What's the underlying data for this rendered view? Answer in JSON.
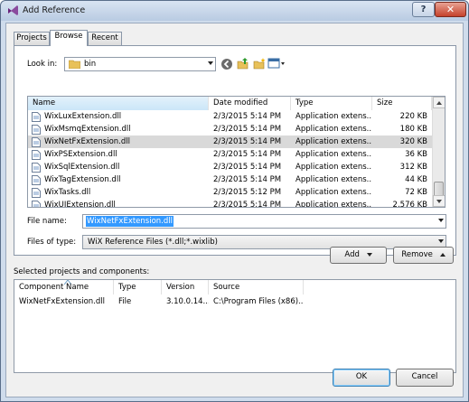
{
  "window": {
    "title": "Add Reference",
    "help_label": "?",
    "close_label": "✕"
  },
  "tabs": [
    {
      "label": "Projects"
    },
    {
      "label": "Browse"
    },
    {
      "label": "Recent"
    }
  ],
  "browse": {
    "look_in_label": "Look in:",
    "look_in_value": "bin",
    "toolbar_icons": [
      "back-icon",
      "up-folder-icon",
      "new-folder-icon",
      "view-menu-icon"
    ],
    "columns": [
      "Name",
      "Date modified",
      "Type",
      "Size"
    ],
    "files": [
      {
        "name": "WixLuxExtension.dll",
        "date": "2/3/2015 5:14 PM",
        "type": "Application extens...",
        "size": "220 KB"
      },
      {
        "name": "WixMsmqExtension.dll",
        "date": "2/3/2015 5:14 PM",
        "type": "Application extens...",
        "size": "180 KB"
      },
      {
        "name": "WixNetFxExtension.dll",
        "date": "2/3/2015 5:14 PM",
        "type": "Application extens...",
        "size": "320 KB"
      },
      {
        "name": "WixPSExtension.dll",
        "date": "2/3/2015 5:14 PM",
        "type": "Application extens...",
        "size": "36 KB"
      },
      {
        "name": "WixSqlExtension.dll",
        "date": "2/3/2015 5:14 PM",
        "type": "Application extens...",
        "size": "312 KB"
      },
      {
        "name": "WixTagExtension.dll",
        "date": "2/3/2015 5:14 PM",
        "type": "Application extens...",
        "size": "44 KB"
      },
      {
        "name": "WixTasks.dll",
        "date": "2/3/2015 5:12 PM",
        "type": "Application extens...",
        "size": "72 KB"
      },
      {
        "name": "WixUIExtension.dll",
        "date": "2/3/2015 5:14 PM",
        "type": "Application extens...",
        "size": "2,576 KB"
      }
    ],
    "selected_index": 2,
    "file_name_label": "File name:",
    "file_name_value": "WixNetFxExtension.dll",
    "file_type_label": "Files of type:",
    "file_type_value": "WiX Reference Files (*.dll;*.wixlib)"
  },
  "actions": {
    "add_label": "Add",
    "remove_label": "Remove"
  },
  "selected": {
    "heading": "Selected projects and components:",
    "columns": [
      "Component Name",
      "Type",
      "Version",
      "Source"
    ],
    "rows": [
      {
        "name": "WixNetFxExtension.dll",
        "type": "File",
        "version": "3.10.0.14...",
        "source": "C:\\Program Files (x86)..."
      }
    ]
  },
  "footer": {
    "ok_label": "OK",
    "cancel_label": "Cancel"
  },
  "colors": {
    "selection": "#d9d9d9",
    "highlight": "#3399ff",
    "title_gradient": "#b9cbe2"
  }
}
